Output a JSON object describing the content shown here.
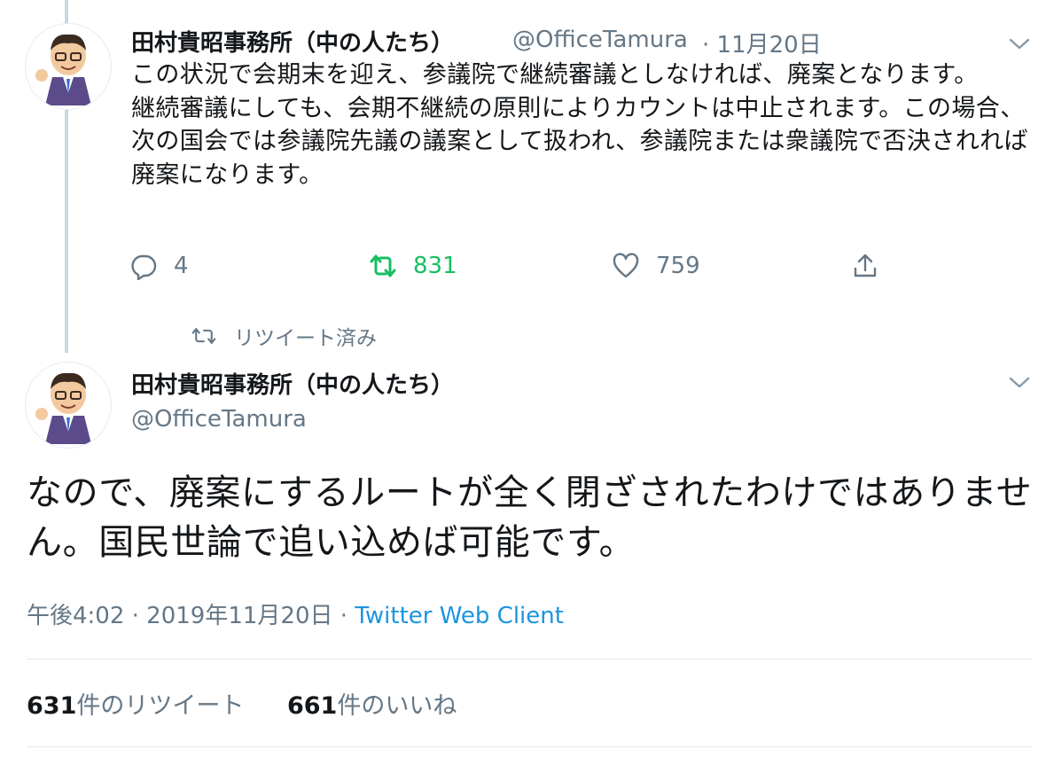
{
  "tweet1": {
    "name": "田村貴昭事務所（中の人たち）",
    "handle": "@OfficeTamura",
    "date": "· 11月20日",
    "paragraphs": [
      "この状況で会期末を迎え、参議院で継続審議としなければ、廃案となります。",
      "継続審議にしても、会期不継続の原則によりカウントは中止されます。この場合、次の国会では参議院先議の議案として扱われ、参議院または衆議院で否決されれば廃案になります。"
    ],
    "reply_count": "4",
    "retweet_count": "831",
    "like_count": "759"
  },
  "retweet_notice": "リツイート済み",
  "tweet2": {
    "name": "田村貴昭事務所（中の人たち）",
    "handle": "@OfficeTamura",
    "text": "なので、廃案にするルートが全く閉ざされたわけではありません。国民世論で追い込めば可能です。",
    "timestamp": "午後4:02 · 2019年11月20日 · ",
    "client": "Twitter Web Client",
    "retweets_num": "631",
    "retweets_label": "件のリツイート",
    "likes_num": "661",
    "likes_label": "件のいいね"
  },
  "colors": {
    "text": "#14171a",
    "secondary": "#657786",
    "retweet_green": "#17bf63",
    "link_blue": "#1b95e0"
  },
  "icons": [
    "avatar-illustration",
    "chevron-down-icon",
    "reply-icon",
    "retweet-icon",
    "like-icon",
    "share-icon"
  ]
}
